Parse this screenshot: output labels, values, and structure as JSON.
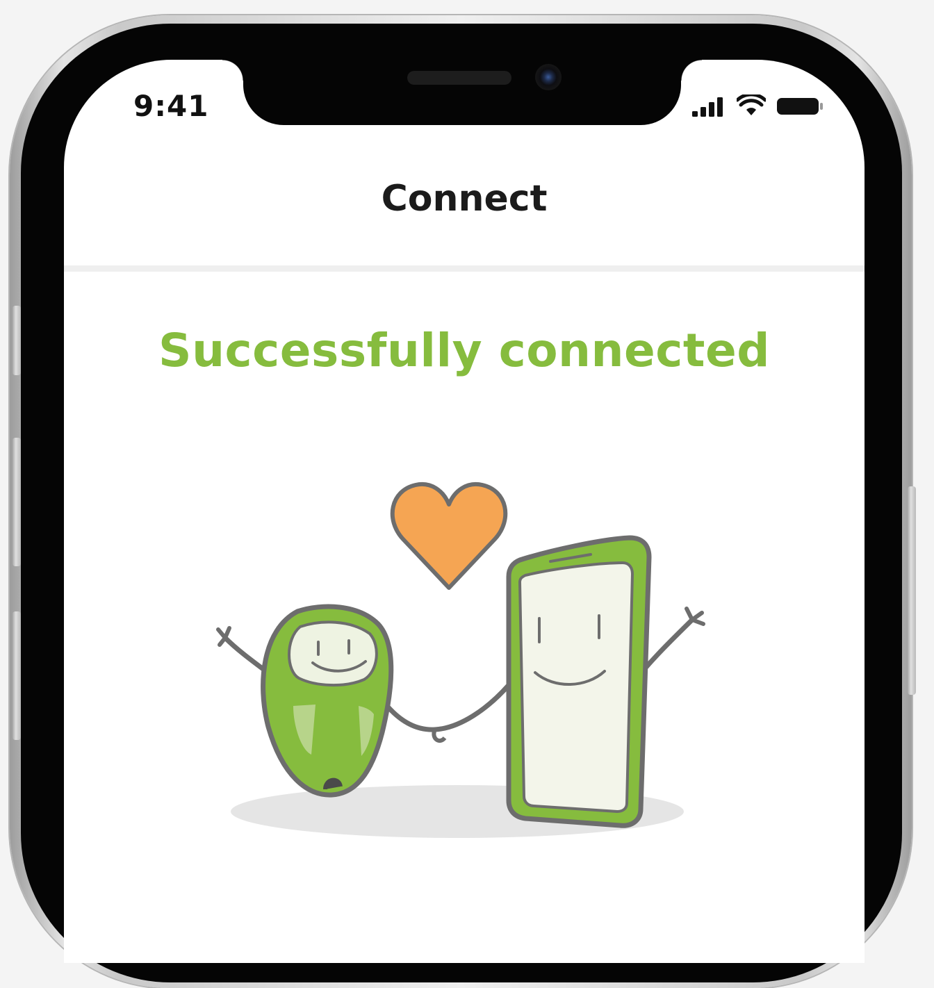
{
  "status_bar": {
    "time": "9:41",
    "icons": [
      "signal-icon",
      "wifi-icon",
      "battery-icon"
    ]
  },
  "nav": {
    "title": "Connect"
  },
  "main": {
    "headline": "Successfully connected",
    "illustration": "device-and-phone-holding-hands-with-heart"
  },
  "colors": {
    "accent_green": "#86bc3e",
    "heart_orange": "#f5a553",
    "outline_gray": "#6d6d6d"
  }
}
